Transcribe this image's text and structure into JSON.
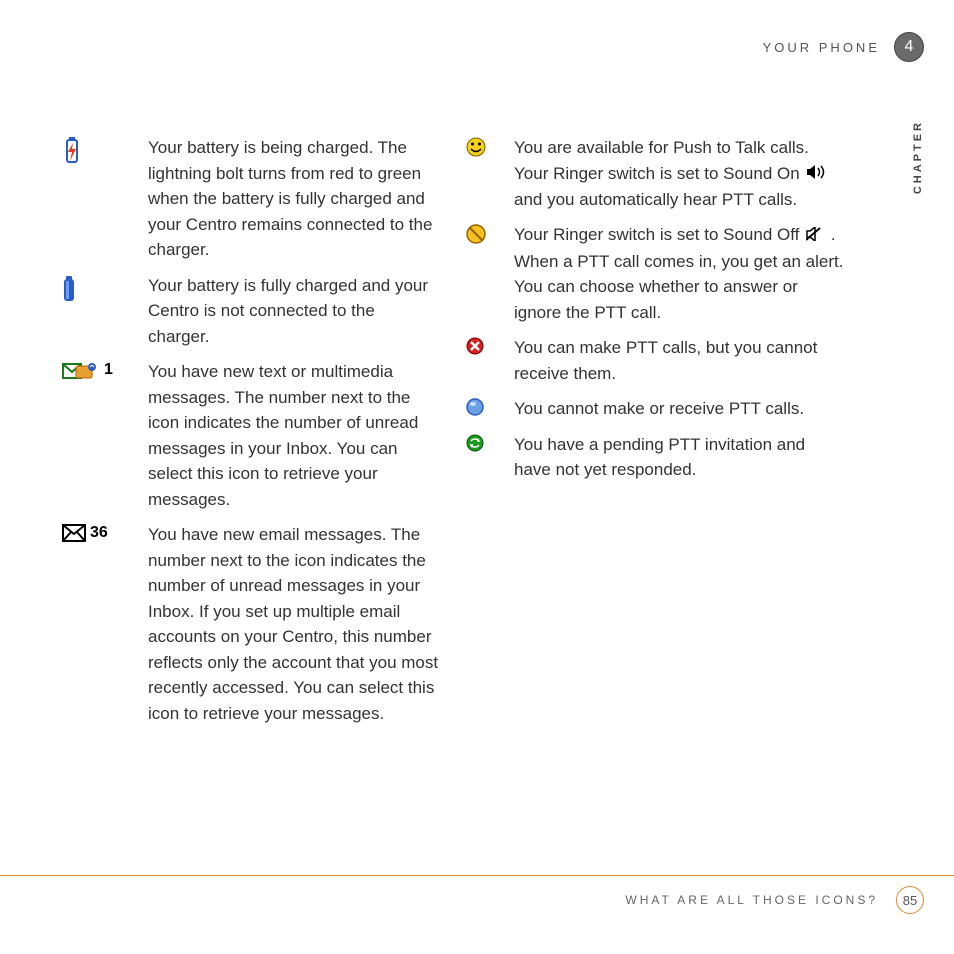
{
  "header": {
    "section": "YOUR PHONE",
    "chapter_num": "4",
    "chapter_label": "CHAPTER"
  },
  "left": [
    {
      "icon": "battery-charging-icon",
      "count": "",
      "text": "Your battery is being charged. The lightning bolt turns from red to green when the battery is fully charged and your Centro remains connected to the charger."
    },
    {
      "icon": "battery-full-icon",
      "count": "",
      "text": "Your battery is fully charged and your Centro is not connected to the charger."
    },
    {
      "icon": "message-icon",
      "count": "1",
      "text": "You have new text or multimedia messages. The number next to the icon indicates the number of unread messages in your Inbox. You can select this icon to retrieve your messages."
    },
    {
      "icon": "email-icon",
      "count": "36",
      "text": "You have new email messages. The number next to the icon indicates the number of unread messages in your Inbox. If you set up multiple email accounts on your Centro, this number reflects only the account that you most recently accessed. You can select this icon to retrieve your messages."
    }
  ],
  "right": [
    {
      "icon": "smiley-icon",
      "text_a": "You are available for Push to Talk calls. Your Ringer switch is set to Sound On ",
      "inline": "sound-on-icon",
      "text_b": " and you automatically hear PTT calls."
    },
    {
      "icon": "silent-icon",
      "text_a": "Your Ringer switch is set to Sound Off ",
      "inline": "sound-off-icon",
      "text_b": ". When a PTT call comes in, you get an alert. You can choose whether to answer or ignore the PTT call."
    },
    {
      "icon": "dnd-icon",
      "text_a": "You can make PTT calls, but you cannot receive them.",
      "inline": "",
      "text_b": ""
    },
    {
      "icon": "offline-icon",
      "text_a": "You cannot make or receive PTT calls.",
      "inline": "",
      "text_b": ""
    },
    {
      "icon": "pending-icon",
      "text_a": "You have a pending PTT invitation and have not yet responded.",
      "inline": "",
      "text_b": ""
    }
  ],
  "footer": {
    "text": "WHAT ARE ALL THOSE ICONS?",
    "page": "85"
  }
}
